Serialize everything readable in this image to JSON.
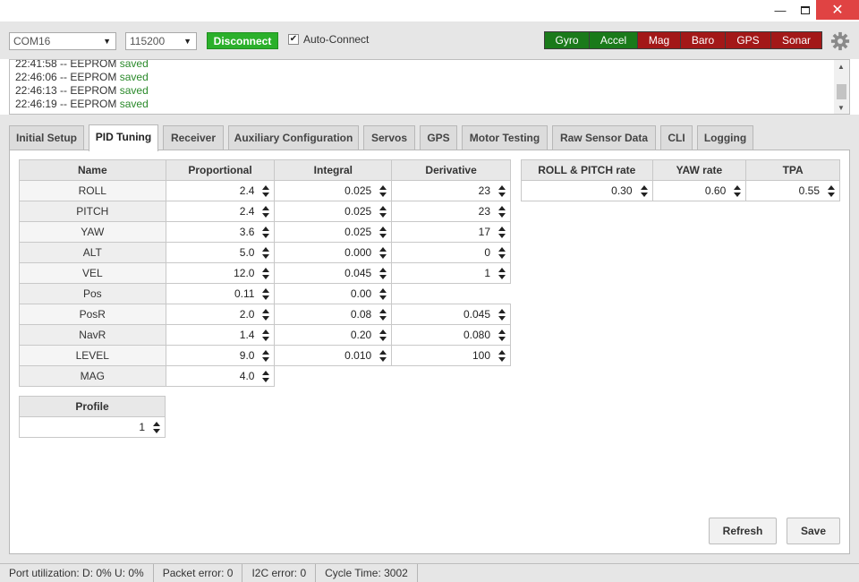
{
  "window": {
    "minimize": "—",
    "close": "✕"
  },
  "connection": {
    "port": "COM16",
    "baud": "115200",
    "disconnect_label": "Disconnect",
    "auto_connect_label": "Auto-Connect",
    "auto_connect_checked": true
  },
  "sensors": [
    {
      "label": "Gyro",
      "state": "ok"
    },
    {
      "label": "Accel",
      "state": "ok"
    },
    {
      "label": "Mag",
      "state": "error"
    },
    {
      "label": "Baro",
      "state": "error"
    },
    {
      "label": "GPS",
      "state": "error"
    },
    {
      "label": "Sonar",
      "state": "error"
    }
  ],
  "log": [
    {
      "time": "22:41:58 -- EEPROM",
      "status": "saved"
    },
    {
      "time": "22:46:06 -- EEPROM",
      "status": "saved"
    },
    {
      "time": "22:46:13 -- EEPROM",
      "status": "saved"
    },
    {
      "time": "22:46:19 -- EEPROM",
      "status": "saved"
    }
  ],
  "tabs": [
    {
      "label": "Initial Setup"
    },
    {
      "label": "PID Tuning",
      "active": true
    },
    {
      "label": "Receiver"
    },
    {
      "label": "Auxiliary Configuration"
    },
    {
      "label": "Servos"
    },
    {
      "label": "GPS"
    },
    {
      "label": "Motor Testing"
    },
    {
      "label": "Raw Sensor Data"
    },
    {
      "label": "CLI"
    },
    {
      "label": "Logging"
    }
  ],
  "pid_table": {
    "headers": [
      "Name",
      "Proportional",
      "Integral",
      "Derivative"
    ],
    "rows": [
      {
        "name": "ROLL",
        "p": "2.4",
        "i": "0.025",
        "d": "23"
      },
      {
        "name": "PITCH",
        "p": "2.4",
        "i": "0.025",
        "d": "23"
      },
      {
        "name": "YAW",
        "p": "3.6",
        "i": "0.025",
        "d": "17"
      },
      {
        "name": "ALT",
        "p": "5.0",
        "i": "0.000",
        "d": "0"
      },
      {
        "name": "VEL",
        "p": "12.0",
        "i": "0.045",
        "d": "1"
      },
      {
        "name": "Pos",
        "p": "0.11",
        "i": "0.00",
        "d": null
      },
      {
        "name": "PosR",
        "p": "2.0",
        "i": "0.08",
        "d": "0.045"
      },
      {
        "name": "NavR",
        "p": "1.4",
        "i": "0.20",
        "d": "0.080"
      },
      {
        "name": "LEVEL",
        "p": "9.0",
        "i": "0.010",
        "d": "100"
      },
      {
        "name": "MAG",
        "p": "4.0",
        "i": null,
        "d": null
      }
    ]
  },
  "rate_table": {
    "headers": [
      "ROLL & PITCH rate",
      "YAW rate",
      "TPA"
    ],
    "values": [
      "0.30",
      "0.60",
      "0.55"
    ]
  },
  "profile": {
    "header": "Profile",
    "value": "1"
  },
  "buttons": {
    "refresh": "Refresh",
    "save": "Save"
  },
  "status": [
    "Port utilization: D: 0% U: 0%",
    "Packet error: 0",
    "I2C error: 0",
    "Cycle Time: 3002"
  ],
  "colors": {
    "connected": "#2bb02b",
    "sensor_ok": "#1a7a1a",
    "sensor_error": "#a31818",
    "log_ok": "#2a8a2a"
  }
}
